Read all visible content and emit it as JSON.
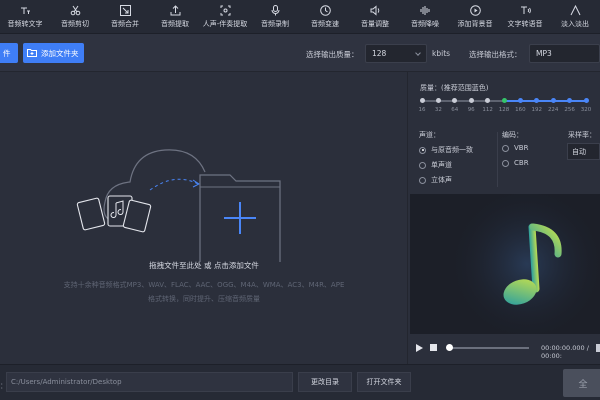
{
  "toolbar": {
    "items": [
      {
        "label": "音频转文字",
        "icon": "speech-to-text-icon"
      },
      {
        "label": "音频剪切",
        "icon": "scissors-icon"
      },
      {
        "label": "音频合并",
        "icon": "merge-icon"
      },
      {
        "label": "音频提取",
        "icon": "extract-icon"
      },
      {
        "label": "人声-伴奏提取",
        "icon": "vocal-split-icon"
      },
      {
        "label": "音频录制",
        "icon": "record-icon"
      },
      {
        "label": "音频变速",
        "icon": "speed-icon"
      },
      {
        "label": "音量调整",
        "icon": "volume-icon"
      },
      {
        "label": "音频降噪",
        "icon": "denoise-icon"
      },
      {
        "label": "添加背景音",
        "icon": "add-bgm-icon"
      },
      {
        "label": "文字转语音",
        "icon": "text-to-speech-icon"
      },
      {
        "label": "淡入淡出",
        "icon": "fade-icon"
      }
    ]
  },
  "actions": {
    "add_file_label": "件",
    "add_folder_label": "添加文件夹"
  },
  "output": {
    "quality_label": "选择输出质量：",
    "quality_value": "128",
    "quality_unit": "kbits",
    "format_label": "选择输出格式：",
    "format_value": "MP3"
  },
  "dropzone": {
    "title": "拖拽文件至此处 或 点击添加文件",
    "description": "支持十余种音频格式MP3、WAV、FLAC、AAC、OGG、M4A、WMA、AC3、M4R、APE格式转换，同时提升、压缩音频质量"
  },
  "settings": {
    "quality_title": "质量：(推荐范围蓝色)",
    "bitrate_ticks": [
      "16",
      "32",
      "64",
      "96",
      "112",
      "128",
      "160",
      "192",
      "224",
      "256",
      "320"
    ],
    "bitrate_selected": "128",
    "channel_title": "声道：",
    "channels": [
      "与原音频一致",
      "单声道",
      "立体声"
    ],
    "channel_selected": "与原音频一致",
    "encoding_title": "编码：",
    "encodings": [
      "VBR",
      "CBR"
    ],
    "samplerate_title": "采样率：",
    "samplerate_value": "自动"
  },
  "player": {
    "time": "00:00:00.000 / 00:00:"
  },
  "bottom": {
    "output_prefix": "：",
    "path": "C:/Users/Administrator/Desktop",
    "change_dir_label": "更改目录",
    "open_folder_label": "打开文件夹",
    "convert_label": "全"
  },
  "colors": {
    "accent": "#3f7ef6",
    "recommended": "#4a86f7",
    "selected_tick": "#35c46a",
    "background": "#2b2f3b"
  }
}
